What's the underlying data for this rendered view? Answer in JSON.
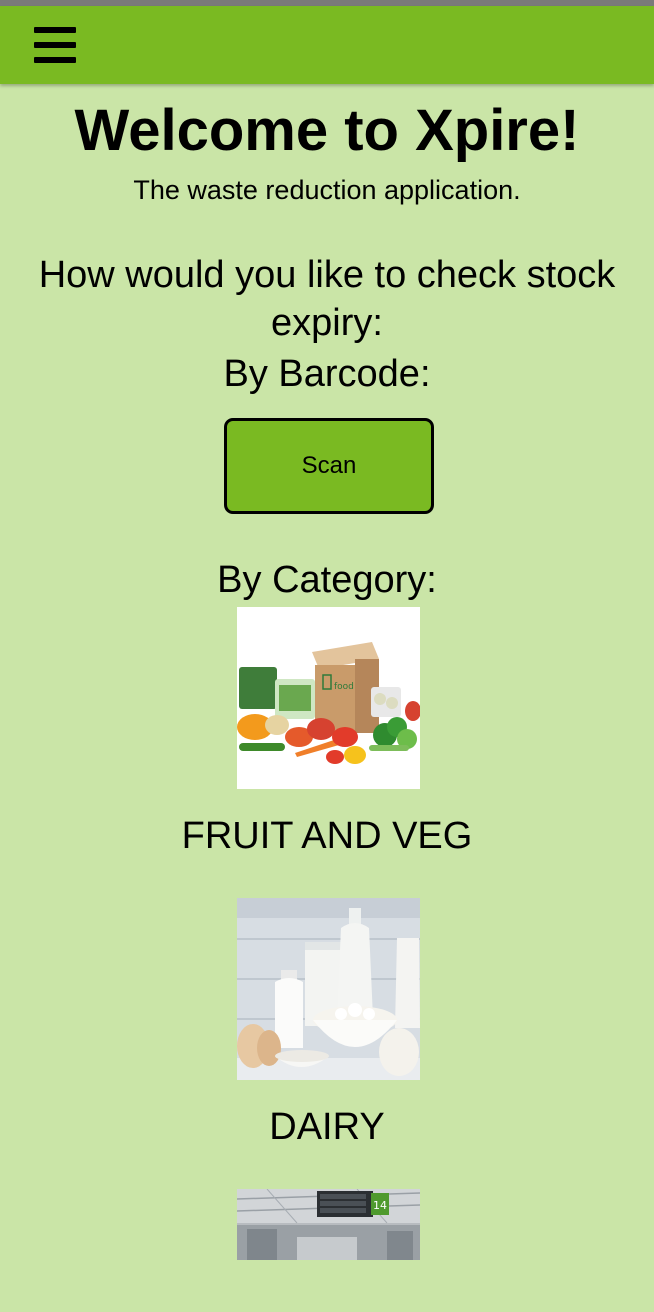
{
  "app_bar": {
    "menu_icon": "hamburger-menu-icon",
    "color": "#7aba22"
  },
  "header": {
    "title": "Welcome to Xpire!",
    "subtitle": "The waste reduction application."
  },
  "prompt": {
    "question": "How would you like to check stock expiry:",
    "by_barcode": "By Barcode:",
    "scan_label": "Scan",
    "by_category": "By Category:"
  },
  "categories": [
    {
      "label": "FRUIT AND VEG",
      "image": "fruit-veg-foodbox-image"
    },
    {
      "label": "DAIRY",
      "image": "dairy-products-image"
    },
    {
      "label": "",
      "image": "supermarket-aisle-image",
      "sign_number": "14"
    }
  ],
  "colors": {
    "background": "#cae5a7",
    "accent": "#7aba22"
  }
}
